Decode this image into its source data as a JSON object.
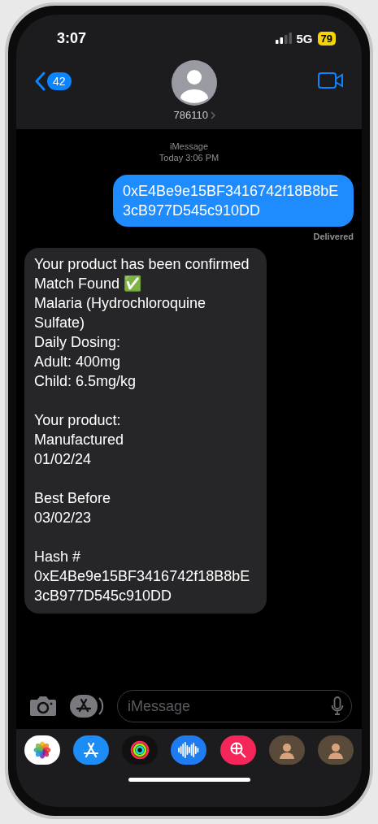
{
  "status_bar": {
    "time": "3:07",
    "network": "5G",
    "battery": "79"
  },
  "nav": {
    "back_count": "42",
    "contact": "786110"
  },
  "thread": {
    "service": "iMessage",
    "timestamp": "Today 3:06 PM",
    "messages": [
      {
        "kind": "sent",
        "text": "0xE4Be9e15BF3416742f18B8bE3cB977D545c910DD",
        "status": "Delivered"
      },
      {
        "kind": "received",
        "paragraphs": [
          "Your product has been confirmed\nMatch Found ✅\nMalaria (Hydrochloroquine Sulfate)\nDaily Dosing:\nAdult: 400mg\nChild: 6.5mg/kg",
          "Your product:\nManufactured\n01/02/24",
          "Best Before\n03/02/23",
          "Hash #\n0xE4Be9e15BF3416742f18B8bE3cB977D545c910DD"
        ]
      }
    ]
  },
  "composer": {
    "placeholder": "iMessage"
  },
  "app_drawer": [
    {
      "kind": "photos"
    },
    {
      "kind": "store"
    },
    {
      "kind": "rings"
    },
    {
      "kind": "audio"
    },
    {
      "kind": "search"
    },
    {
      "kind": "avatar"
    },
    {
      "kind": "avatar"
    }
  ]
}
